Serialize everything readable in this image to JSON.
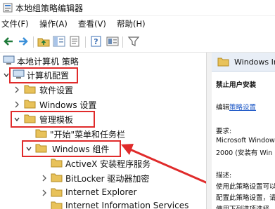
{
  "window": {
    "title": "本地组策略编辑器"
  },
  "menu": [
    "文件(F)",
    "操作(A)",
    "查看(V)",
    "帮助(H)"
  ],
  "tree": {
    "root": "本地计算机 策略",
    "computer_config": "计算机配置",
    "software_settings": "软件设置",
    "windows_settings": "Windows 设置",
    "admin_templates": "管理模板",
    "start_menu": "\"开始\"菜单和任务栏",
    "windows_components": "Windows 组件",
    "activex": "ActiveX 安装程序服务",
    "bitlocker": "BitLocker 驱动器加密",
    "ie": "Internet Explorer",
    "iis": "Internet Information Services"
  },
  "right_pane": {
    "header": "Windows In",
    "heading": "禁止用户安装",
    "edit_prefix": "编辑",
    "edit_link": "策略设置",
    "requirements_label": "要求:",
    "requirements_line1": "Microsoft Window",
    "requirements_line2": "2000 (安装有 Win",
    "description_label": "描述:",
    "desc_line1": "使用此策略设置可以",
    "desc_line2": "配置此策略设置，请",
    "desc_line3": "使用下列选项选择"
  },
  "colors": {
    "highlight": "#e02b2b",
    "folder": "#e8c25a",
    "accent": "#1a56c6"
  }
}
